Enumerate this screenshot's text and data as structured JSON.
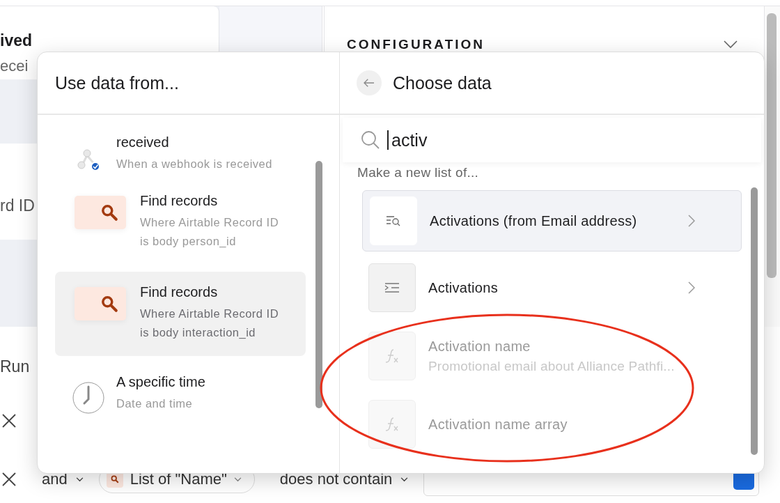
{
  "background": {
    "card_title": "ived",
    "card_subtitle": "ecei",
    "field_label": "rd ID",
    "section_label": "Run",
    "configuration": {
      "heading": "CONFIGURATION",
      "expanded": true
    },
    "condition": {
      "joiner": "and",
      "chip": "List of \"Name\"",
      "operator": "does not contain"
    }
  },
  "popover": {
    "sources": {
      "title": "Use data from...",
      "items": [
        {
          "kind": "webhook",
          "title": "received",
          "description": "When a webhook is received",
          "selected": false
        },
        {
          "kind": "search",
          "title": "Find records",
          "description": "Where Airtable Record ID is body person_id",
          "selected": false
        },
        {
          "kind": "search",
          "title": "Find records",
          "description": "Where Airtable Record ID is body interaction_id",
          "selected": true
        },
        {
          "kind": "time",
          "title": "A specific time",
          "description": "Date and time",
          "selected": false
        }
      ]
    },
    "data": {
      "title": "Choose data",
      "search": {
        "value": "activ"
      },
      "section_label": "Make a new list of...",
      "items": [
        {
          "kind": "related_list",
          "title": "Activations (from Email address)",
          "selected": true,
          "disabled": false
        },
        {
          "kind": "list",
          "title": "Activations",
          "selected": false,
          "disabled": false
        },
        {
          "kind": "field",
          "title": "Activation name",
          "subtitle": "Promotional email about Alliance Pathfi...",
          "selected": false,
          "disabled": true
        },
        {
          "kind": "field",
          "title": "Activation name array",
          "selected": false,
          "disabled": true
        }
      ]
    }
  }
}
